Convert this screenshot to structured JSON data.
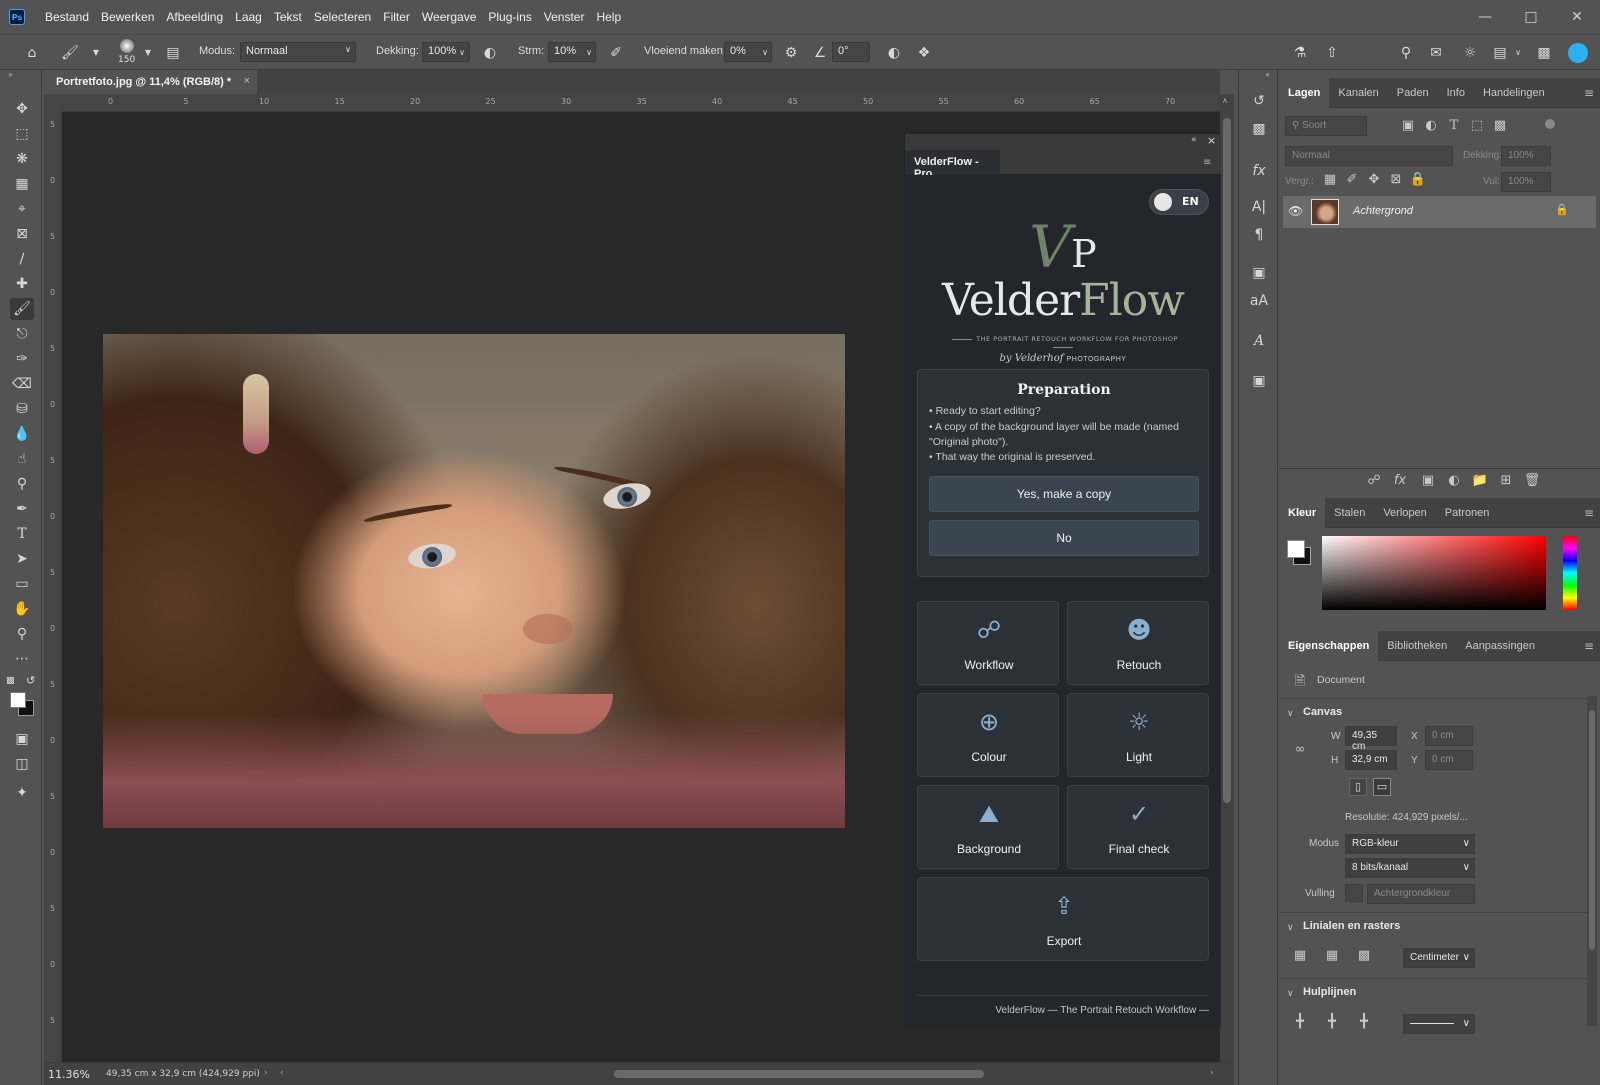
{
  "menu": [
    "Bestand",
    "Bewerken",
    "Afbeelding",
    "Laag",
    "Tekst",
    "Selecteren",
    "Filter",
    "Weergave",
    "Plug-ins",
    "Venster",
    "Help"
  ],
  "app_logo": "Ps",
  "options": {
    "brush_size": "150",
    "mode_label": "Modus:",
    "mode_value": "Normaal",
    "opacity_label": "Dekking:",
    "opacity_value": "100%",
    "flow_label": "Strm:",
    "flow_value": "10%",
    "smoothing_label": "Vloeiend maken:",
    "smoothing_value": "0%",
    "angle_value": "0°"
  },
  "document": {
    "tab_title": "Portretfoto.jpg @ 11,4% (RGB/8) *",
    "zoom": "11.36%",
    "dimensions": "49,35 cm x 32,9 cm (424,929 ppi)"
  },
  "ruler_h": [
    "0",
    "5",
    "10",
    "15",
    "20",
    "25",
    "30",
    "35",
    "40",
    "45",
    "50",
    "55",
    "60",
    "65",
    "70"
  ],
  "ruler_v": [
    "5",
    "0",
    "5",
    "0",
    "5",
    "0",
    "5",
    "0",
    "5",
    "0",
    "5",
    "0",
    "5",
    "0",
    "5",
    "0",
    "5"
  ],
  "plugin": {
    "tab": "VelderFlow - Pro",
    "lang_toggle": "EN",
    "logo_mono_v": "V",
    "logo_mono_p": "P",
    "logo_word_1": "Velder",
    "logo_word_2": "Flow",
    "logo_tagline": "THE PORTRAIT RETOUCH WORKFLOW FOR PHOTOSHOP",
    "logo_by": "by Velderhof",
    "logo_photography": "PHOTOGRAPHY",
    "prep": {
      "title": "Preparation",
      "line1": "• Ready to start editing?",
      "line2": "• A copy of the background layer will be made (named \"Original photo\").",
      "line3": "• That way the original is preserved.",
      "yes": "Yes, make a copy",
      "no": "No"
    },
    "cards": {
      "workflow": "Workflow",
      "retouch": "Retouch",
      "colour": "Colour",
      "light": "Light",
      "background": "Background",
      "final_check": "Final check",
      "export": "Export"
    },
    "footer": "VelderFlow — The Portrait Retouch Workflow —"
  },
  "layers_panel": {
    "tabs": [
      "Lagen",
      "Kanalen",
      "Paden",
      "Info",
      "Handelingen"
    ],
    "search_placeholder": "Soort",
    "blend": "Normaal",
    "opacity_label": "Dekking:",
    "opacity": "100%",
    "lock_label": "Vergr.:",
    "fill_label": "Vul:",
    "fill": "100%",
    "layer_name": "Achtergrond"
  },
  "color_panel": {
    "tabs": [
      "Kleur",
      "Stalen",
      "Verlopen",
      "Patronen"
    ]
  },
  "props_panel": {
    "tabs": [
      "Eigenschappen",
      "Bibliotheken",
      "Aanpassingen"
    ],
    "doc_label": "Document",
    "canvas_section": "Canvas",
    "w_label": "W",
    "w_value": "49,35 cm",
    "h_label": "H",
    "h_value": "32,9 cm",
    "x_label": "X",
    "x_value": "0 cm",
    "y_label": "Y",
    "y_value": "0 cm",
    "resolution": "Resolutie: 424,929 pixels/...",
    "mode_label": "Modus",
    "mode_value": "RGB-kleur",
    "bits_value": "8 bits/kanaal",
    "fill_label": "Vulling",
    "fill_value": "Achtergrondkleur",
    "rulers_section": "Linialen en rasters",
    "units_value": "Centimeter",
    "guides_section": "Hulplijnen"
  }
}
